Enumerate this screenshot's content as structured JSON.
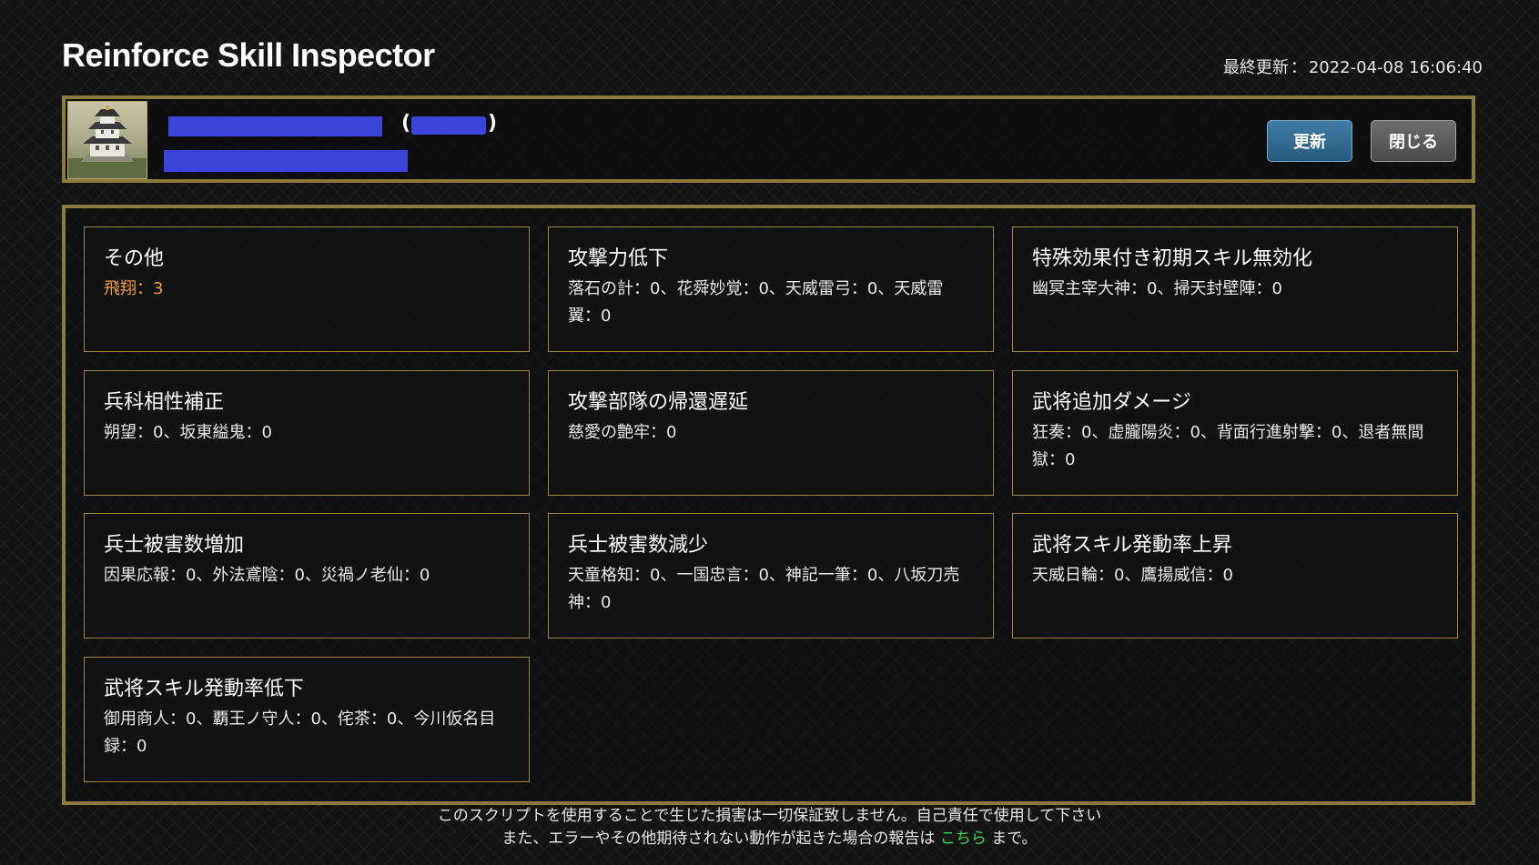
{
  "app": {
    "title": "Reinforce Skill Inspector"
  },
  "last_updated": {
    "label": "最終更新",
    "separator": "：",
    "value": "2022-04-08 16:06:40"
  },
  "header": {
    "paren_open": "(",
    "paren_close": ")",
    "update_button": "更新",
    "close_button": "閉じる"
  },
  "cards": [
    {
      "title": "その他",
      "body": "飛翔：3"
    },
    {
      "title": "攻撃力低下",
      "body": "落石の計：0、花舜妙覚：0、天威雷弓：0、天威雷翼：0"
    },
    {
      "title": "特殊効果付き初期スキル無効化",
      "body": "幽冥主宰大神：0、掃天封壁陣：0"
    },
    {
      "title": "兵科相性補正",
      "body": "朔望：0、坂東縊鬼：0"
    },
    {
      "title": "攻撃部隊の帰還遅延",
      "body": "慈愛の艶牢：0"
    },
    {
      "title": "武将追加ダメージ",
      "body": "狂奏：0、虚朧陽炎：0、背面行進射撃：0、退者無間獄：0"
    },
    {
      "title": "兵士被害数増加",
      "body": "因果応報：0、外法鳶陰：0、災禍ノ老仙：0"
    },
    {
      "title": "兵士被害数減少",
      "body": "天童格知：0、一国忠言：0、神記一筆：0、八坂刀売神：0"
    },
    {
      "title": "武将スキル発動率上昇",
      "body": "天威日輪：0、鷹揚威信：0"
    },
    {
      "title": "武将スキル発動率低下",
      "body": "御用商人：0、覇王ノ守人：0、侘茶：0、今川仮名目録：0"
    }
  ],
  "footer": {
    "line1": "このスクリプトを使用することで生じた損害は一切保証致しません。自己責任で使用して下さい",
    "line2_prefix": "また、エラーやその他期待されない動作が起きた場合の報告は",
    "link_text": "こちら",
    "line2_suffix": "まで。"
  },
  "colors": {
    "gold_border": "#8a7a3c",
    "highlight_text": "#f0a030",
    "link": "#33dd55",
    "update_button": "#3f7da6",
    "redaction": "#3b45d9"
  },
  "icons": {
    "castle": "castle-icon"
  }
}
